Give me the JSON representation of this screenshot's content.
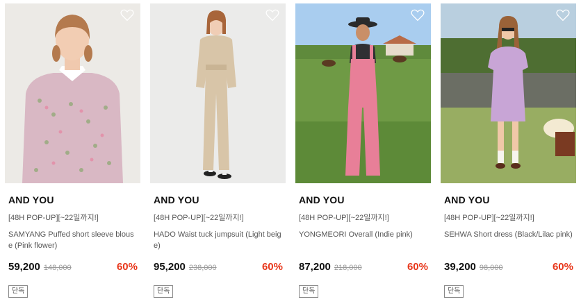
{
  "products": [
    {
      "image_alt": "SAMYANG Puffed short sleeve blouse photo",
      "heart_icon": "heart-outline-icon",
      "brand": "AND YOU",
      "promo": "[48H POP-UP][~22일까지!]",
      "name": "SAMYANG Puffed short sleeve blouse (Pink flower)",
      "price": "59,200",
      "original_price": "148,000",
      "discount": "60%",
      "badge": "단독"
    },
    {
      "image_alt": "HADO Waist tuck jumpsuit photo",
      "heart_icon": "heart-outline-icon",
      "brand": "AND YOU",
      "promo": "[48H POP-UP][~22일까지!]",
      "name": "HADO Waist tuck jumpsuit (Light beige)",
      "price": "95,200",
      "original_price": "238,000",
      "discount": "60%",
      "badge": "단독"
    },
    {
      "image_alt": "YONGMEORI Overall photo",
      "heart_icon": "heart-outline-icon",
      "brand": "AND YOU",
      "promo": "[48H POP-UP][~22일까지!]",
      "name": "YONGMEORI Overall (Indie pink)",
      "price": "87,200",
      "original_price": "218,000",
      "discount": "60%",
      "badge": "단독"
    },
    {
      "image_alt": "SEHWA Short dress photo",
      "heart_icon": "heart-outline-icon",
      "brand": "AND YOU",
      "promo": "[48H POP-UP][~22일까지!]",
      "name": "SEHWA Short dress (Black/Lilac pink)",
      "price": "39,200",
      "original_price": "98,000",
      "discount": "60%",
      "badge": "단독"
    }
  ],
  "colors": {
    "discount": "#e8361a",
    "text": "#111111",
    "muted": "#555555"
  }
}
